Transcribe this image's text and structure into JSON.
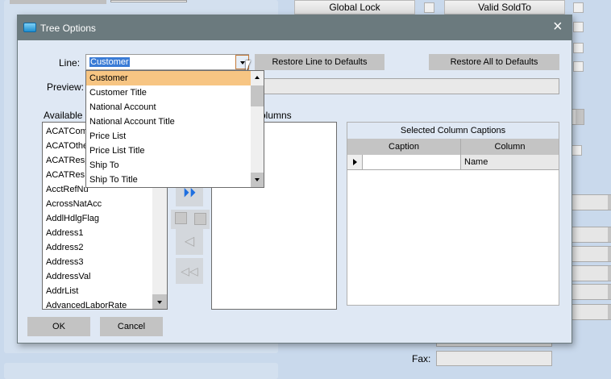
{
  "background": {
    "global_lock_label": "Global Lock",
    "valid_soldto_label": "Valid SoldTo",
    "fax_label": "Fax:"
  },
  "dialog": {
    "title": "Tree Options",
    "line_label": "Line:",
    "line_value": "Customer",
    "restore_line_label": "Restore Line to Defaults",
    "restore_all_label": "Restore All to Defaults",
    "preview_label": "Preview:",
    "available_label": "Available",
    "selected_columns_label": "olumns",
    "line_options": [
      "Customer",
      "Customer Title",
      "National Account",
      "National Account Title",
      "Price List",
      "Price List Title",
      "Ship To",
      "Ship To Title"
    ],
    "available_items": [
      "ACATCom",
      "ACATOthe",
      "ACATResp",
      "ACATRes",
      "AcctRefNu",
      "AcrossNatAcc",
      "AddlHdlgFlag",
      "Address1",
      "Address2",
      "Address3",
      "AddressVal",
      "AddrList",
      "AdvancedLaborRate"
    ],
    "captions": {
      "title": "Selected Column Captions",
      "headers": [
        "Caption",
        "Column"
      ],
      "rows": [
        {
          "caption": "",
          "column": "Name"
        }
      ]
    },
    "ok_label": "OK",
    "cancel_label": "Cancel"
  },
  "colors": {
    "titlebar": "#6b7a7e",
    "dialog_bg": "#dfe8f4",
    "selected_option": "#f7c583",
    "selection": "#3a7bd5"
  }
}
